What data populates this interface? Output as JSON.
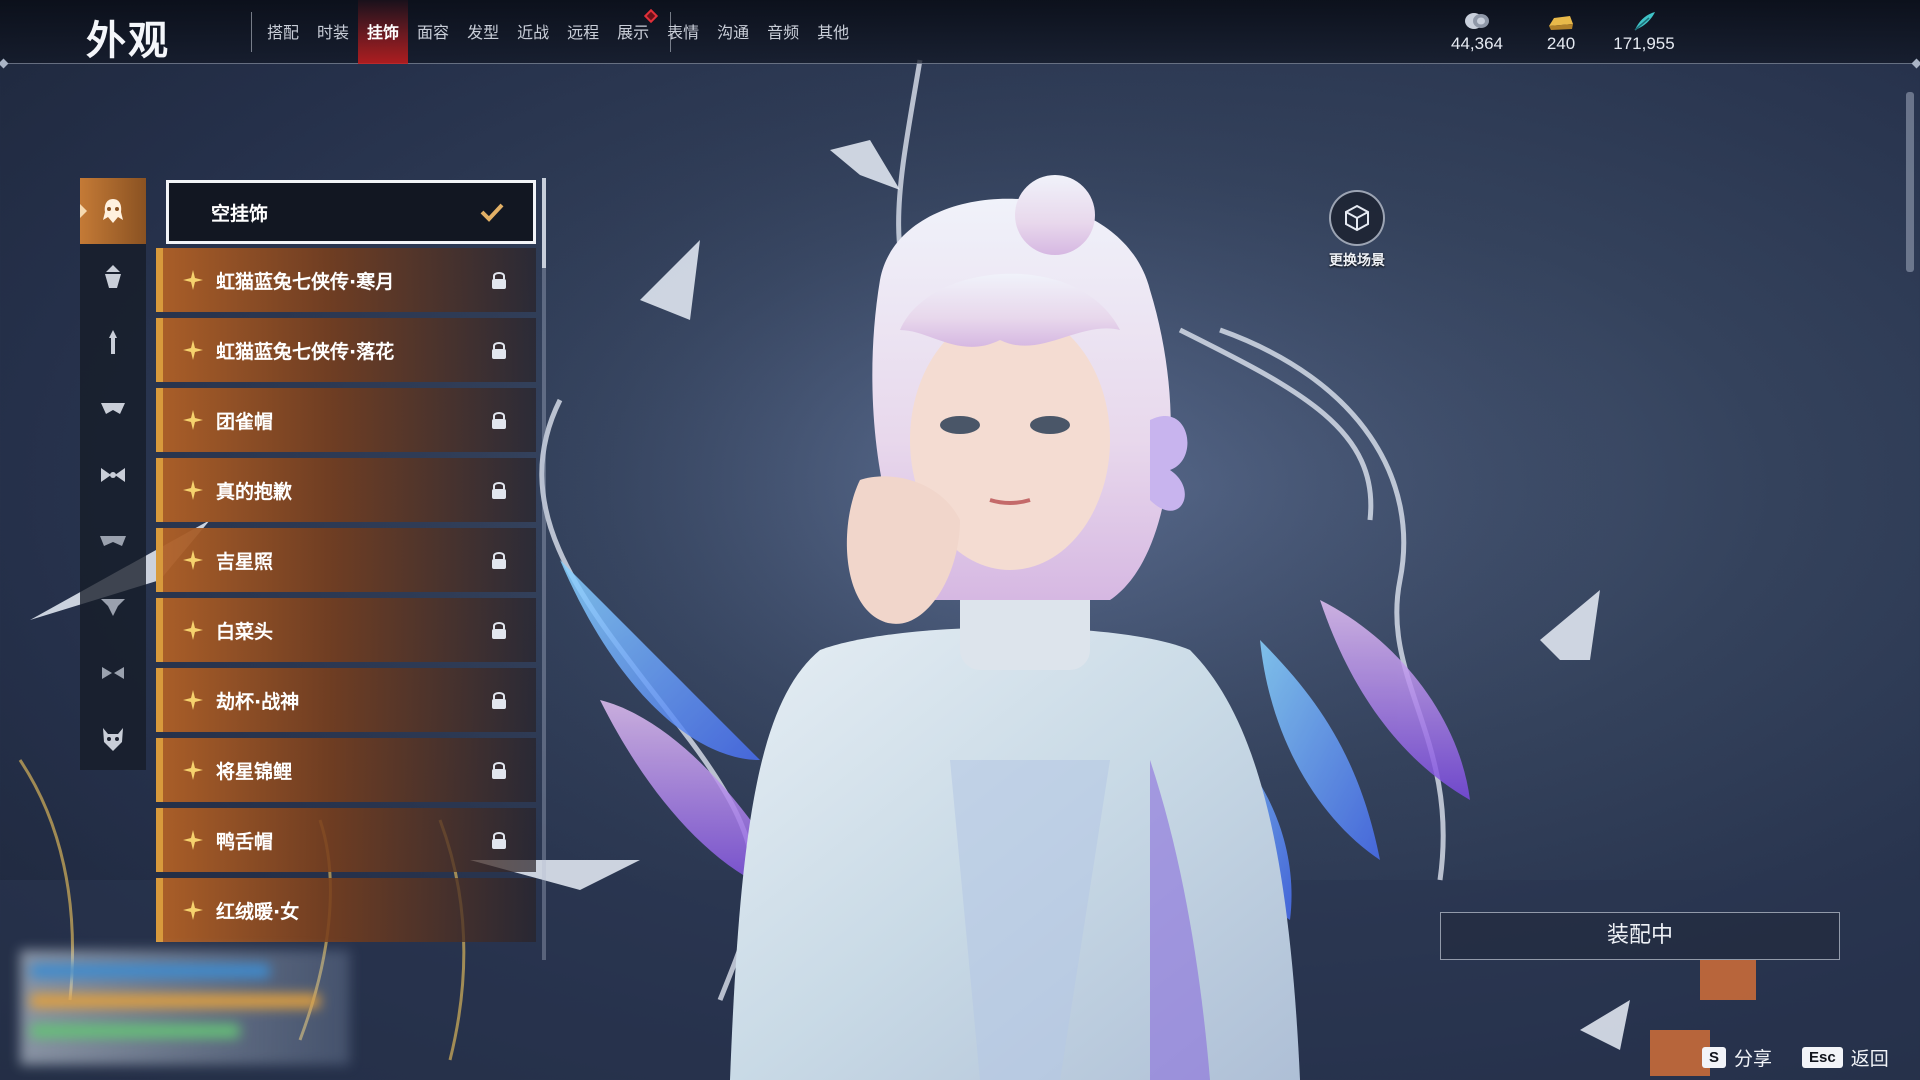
{
  "page": {
    "title": "外观"
  },
  "nav": {
    "tabs": [
      {
        "label": "搭配",
        "active": false,
        "badge": false
      },
      {
        "label": "时装",
        "active": false,
        "badge": false
      },
      {
        "label": "挂饰",
        "active": true,
        "badge": false
      },
      {
        "label": "面容",
        "active": false,
        "badge": false
      },
      {
        "label": "发型",
        "active": false,
        "badge": false
      },
      {
        "label": "近战",
        "active": false,
        "badge": false
      },
      {
        "label": "远程",
        "active": false,
        "badge": false
      },
      {
        "label": "展示",
        "active": false,
        "badge": true
      },
      {
        "label": "表情",
        "active": false,
        "badge": false
      },
      {
        "label": "沟通",
        "active": false,
        "badge": false
      },
      {
        "label": "音频",
        "active": false,
        "badge": false
      },
      {
        "label": "其他",
        "active": false,
        "badge": false
      }
    ]
  },
  "currencies": [
    {
      "icon": "silver-coin-icon",
      "value": "44,364",
      "color": "#c9d0dc"
    },
    {
      "icon": "gold-ingot-icon",
      "value": "240",
      "color": "#e8b94a"
    },
    {
      "icon": "jade-feather-icon",
      "value": "171,955",
      "color": "#3fc3c7"
    }
  ],
  "categories": [
    {
      "icon": "ghost-mask-icon",
      "active": true
    },
    {
      "icon": "hat-icon",
      "active": false
    },
    {
      "icon": "hairpin-icon",
      "active": false
    },
    {
      "icon": "face-accessory-icon",
      "active": false
    },
    {
      "icon": "bow-icon",
      "active": false
    },
    {
      "icon": "ribbon-icon",
      "active": false
    },
    {
      "icon": "back-accessory-icon",
      "active": false
    },
    {
      "icon": "waist-bow-icon",
      "active": false
    },
    {
      "icon": "demon-mask-icon",
      "active": false
    }
  ],
  "accessories": [
    {
      "label": "空挂饰",
      "selected": true,
      "locked": false
    },
    {
      "label": "虹猫蓝兔七侠传·寒月",
      "selected": false,
      "locked": true
    },
    {
      "label": "虹猫蓝兔七侠传·落花",
      "selected": false,
      "locked": true
    },
    {
      "label": "团雀帽",
      "selected": false,
      "locked": true
    },
    {
      "label": "真的抱歉",
      "selected": false,
      "locked": true
    },
    {
      "label": "吉星照",
      "selected": false,
      "locked": true
    },
    {
      "label": "白菜头",
      "selected": false,
      "locked": true
    },
    {
      "label": "劫杯·战神",
      "selected": false,
      "locked": true
    },
    {
      "label": "将星锦鲤",
      "selected": false,
      "locked": true
    },
    {
      "label": "鸭舌帽",
      "selected": false,
      "locked": true
    },
    {
      "label": "红绒暖·女",
      "selected": false,
      "locked": false
    }
  ],
  "scene_button": {
    "label": "更换场景",
    "icon": "cube-scene-icon"
  },
  "equip_status": {
    "label": "装配中"
  },
  "hints": [
    {
      "key": "S",
      "label": "分享"
    },
    {
      "key": "Esc",
      "label": "返回"
    }
  ],
  "colors": {
    "accent": "#d89a3c",
    "active_tab": "#c81c1c",
    "badge": "#e0303a"
  }
}
